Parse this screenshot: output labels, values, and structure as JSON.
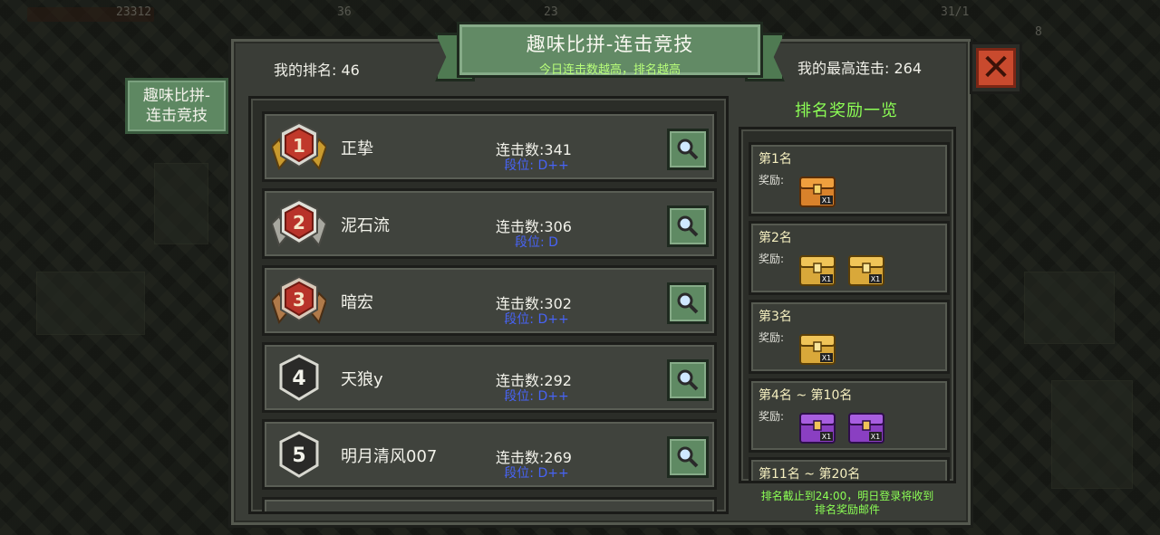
{
  "hud": {
    "left_value": "23312",
    "mid_value_1": "36",
    "mid_value_2": "23",
    "right_value": "31/1",
    "right_small": "8"
  },
  "side_tab": {
    "line1": "趣味比拼-",
    "line2": "连击竞技"
  },
  "banner": {
    "title": "趣味比拼-连击竞技",
    "subtitle": "今日连击数越高，排名越高"
  },
  "my_rank_label": "我的排名: 46",
  "my_best_label": "我的最高连击: 264",
  "close_glyph": "✕",
  "rankings": [
    {
      "rank": "1",
      "name": "正挚",
      "combo": "连击数:341",
      "tier": "段位: D++",
      "medal": "gold"
    },
    {
      "rank": "2",
      "name": "泥石流",
      "combo": "连击数:306",
      "tier": "段位: D",
      "medal": "silver"
    },
    {
      "rank": "3",
      "name": "暗宏",
      "combo": "连击数:302",
      "tier": "段位: D++",
      "medal": "bronze"
    },
    {
      "rank": "4",
      "name": "天狼y",
      "combo": "连击数:292",
      "tier": "段位: D++",
      "medal": "plain"
    },
    {
      "rank": "5",
      "name": "明月清风007",
      "combo": "连击数:269",
      "tier": "段位: D++",
      "medal": "plain"
    }
  ],
  "rewards": {
    "title": "排名奖励一览",
    "reward_label": "奖励:",
    "tiers": [
      {
        "title": "第1名",
        "chests": [
          "orange"
        ]
      },
      {
        "title": "第2名",
        "chests": [
          "gold",
          "gold"
        ]
      },
      {
        "title": "第3名",
        "chests": [
          "gold"
        ]
      },
      {
        "title": "第4名 ~ 第10名",
        "chests": [
          "purple",
          "purple"
        ]
      },
      {
        "title": "第11名 ~ 第20名",
        "chests": []
      }
    ],
    "note_line1": "排名截止到24:00，明日登录将收到",
    "note_line2": "排名奖励邮件"
  },
  "colors": {
    "accent_green": "#8cff55",
    "tier_blue": "#4763f5",
    "close_red": "#c94a2e",
    "panel_green": "#628a65"
  }
}
